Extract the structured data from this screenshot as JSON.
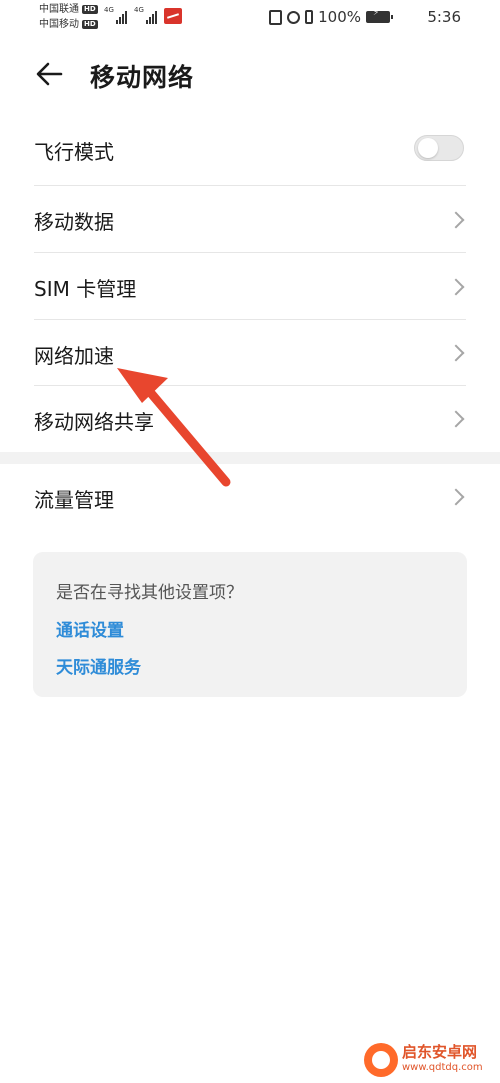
{
  "status_bar": {
    "carrier_1": "中国联通",
    "carrier_2": "中国移动",
    "hd_badge": "HD",
    "network_type": "4G",
    "battery": "100%",
    "time": "5:36"
  },
  "header": {
    "back_icon": "arrow-left-icon",
    "title": "移动网络"
  },
  "list": {
    "airplane_mode": {
      "label": "飞行模式",
      "enabled": false
    },
    "mobile_data": {
      "label": "移动数据"
    },
    "sim_management": {
      "label": "SIM 卡管理"
    },
    "network_acceleration": {
      "label": "网络加速"
    },
    "hotspot": {
      "label": "移动网络共享"
    },
    "data_usage": {
      "label": "流量管理"
    }
  },
  "suggestions": {
    "question": "是否在寻找其他设置项？",
    "links": [
      "通话设置",
      "天际通服务"
    ]
  },
  "watermark": {
    "name": "启东安卓网",
    "url": "www.qdtdq.com"
  },
  "colors": {
    "link": "#2f8cd8",
    "annotation_arrow": "#e8462e",
    "toggle_off": "#e8e8e8"
  }
}
